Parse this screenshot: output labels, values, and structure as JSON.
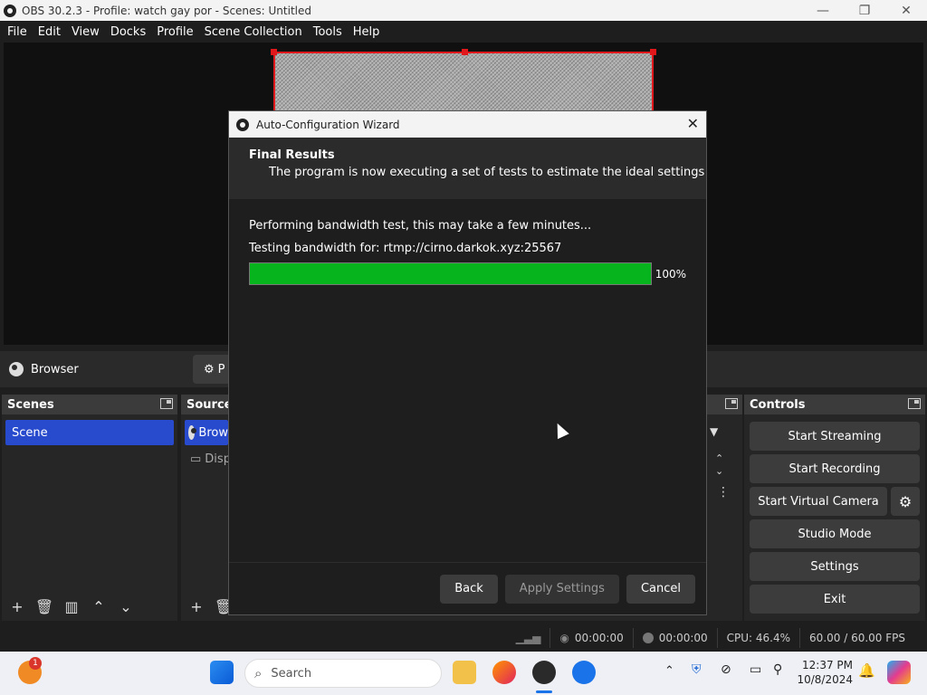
{
  "window": {
    "title": "OBS 30.2.3 - Profile: watch gay por - Scenes: Untitled",
    "minimize": "—",
    "maximize": "❐",
    "close": "✕"
  },
  "menu": [
    "File",
    "Edit",
    "View",
    "Docks",
    "Profile",
    "Scene Collection",
    "Tools",
    "Help"
  ],
  "source_toolbar": {
    "source_name": "Browser",
    "properties_label": "P"
  },
  "scenes_dock": {
    "title": "Scenes",
    "items": [
      "Scene"
    ]
  },
  "sources_dock": {
    "title": "Source",
    "items": [
      "Brow",
      "Disp"
    ]
  },
  "controls_dock": {
    "title": "Controls",
    "buttons": {
      "start_streaming": "Start Streaming",
      "start_recording": "Start Recording",
      "start_virtual_camera": "Start Virtual Camera",
      "studio_mode": "Studio Mode",
      "settings": "Settings",
      "exit": "Exit"
    }
  },
  "statusbar": {
    "stream_time": "00:00:00",
    "record_time": "00:00:00",
    "cpu": "CPU: 46.4%",
    "fps": "60.00 / 60.00 FPS"
  },
  "dialog": {
    "title": "Auto-Configuration Wizard",
    "header_title": "Final Results",
    "header_subtitle": "The program is now executing a set of tests to estimate the ideal settings",
    "status_line": "Performing bandwidth test, this may take a few minutes...",
    "server_line": "Testing bandwidth for: rtmp://cirno.darkok.xyz:25567",
    "progress_percent": 100,
    "progress_label": "100%",
    "buttons": {
      "back": "Back",
      "apply": "Apply Settings",
      "cancel": "Cancel"
    }
  },
  "taskbar": {
    "search_placeholder": "Search",
    "time": "12:37 PM",
    "date": "10/8/2024",
    "notification_badge": "1"
  },
  "colors": {
    "accent": "#284bcd",
    "progress": "#06b41e",
    "selection_border": "#e0181b"
  }
}
